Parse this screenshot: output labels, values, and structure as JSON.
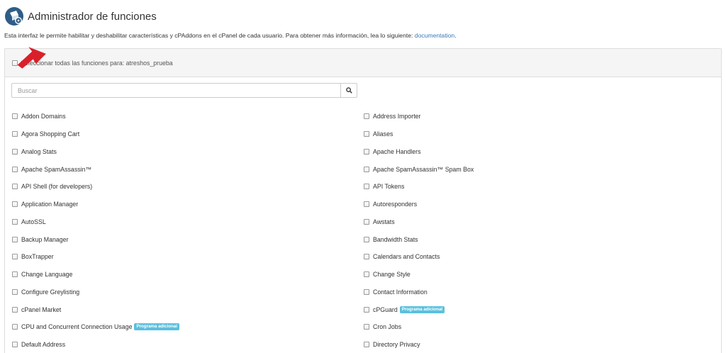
{
  "header": {
    "title": "Administrador de funciones",
    "icon": "feature-manager-icon"
  },
  "description": {
    "text": "Esta interfaz le permite habilitar y deshabilitar características y cPAddons en el cPanel de cada usuario. Para obtener más información, lea lo siguiente: ",
    "link_text": "documentation",
    "link_suffix": "."
  },
  "select_all": {
    "label": "Seleccionar todas las funciones para: atreshos_prueba",
    "checked": false
  },
  "search": {
    "placeholder": "Buscar",
    "value": "",
    "icon": "search-icon"
  },
  "features": {
    "left": [
      {
        "label": "Addon Domains",
        "badge": ""
      },
      {
        "label": "Agora Shopping Cart",
        "badge": ""
      },
      {
        "label": "Analog Stats",
        "badge": ""
      },
      {
        "label": "Apache SpamAssassin™",
        "badge": ""
      },
      {
        "label": "API Shell (for developers)",
        "badge": ""
      },
      {
        "label": "Application Manager",
        "badge": ""
      },
      {
        "label": "AutoSSL",
        "badge": ""
      },
      {
        "label": "Backup Manager",
        "badge": ""
      },
      {
        "label": "BoxTrapper",
        "badge": ""
      },
      {
        "label": "Change Language",
        "badge": ""
      },
      {
        "label": "Configure Greylisting",
        "badge": ""
      },
      {
        "label": "cPanel Market",
        "badge": ""
      },
      {
        "label": "CPU and Concurrent Connection Usage",
        "badge": "Programa adicional"
      },
      {
        "label": "Default Address",
        "badge": ""
      }
    ],
    "right": [
      {
        "label": "Address Importer",
        "badge": ""
      },
      {
        "label": "Aliases",
        "badge": ""
      },
      {
        "label": "Apache Handlers",
        "badge": ""
      },
      {
        "label": "Apache SpamAssassin™ Spam Box",
        "badge": ""
      },
      {
        "label": "API Tokens",
        "badge": ""
      },
      {
        "label": "Autoresponders",
        "badge": ""
      },
      {
        "label": "Awstats",
        "badge": ""
      },
      {
        "label": "Bandwidth Stats",
        "badge": ""
      },
      {
        "label": "Calendars and Contacts",
        "badge": ""
      },
      {
        "label": "Change Style",
        "badge": ""
      },
      {
        "label": "Contact Information",
        "badge": ""
      },
      {
        "label": "cPGuard",
        "badge": "Programa adicional"
      },
      {
        "label": "Cron Jobs",
        "badge": ""
      },
      {
        "label": "Directory Privacy",
        "badge": ""
      }
    ]
  },
  "colors": {
    "link": "#337ab7",
    "badge": "#5bc0de",
    "arrow": "#d9202a",
    "panel_heading_bg": "#f5f5f5"
  }
}
